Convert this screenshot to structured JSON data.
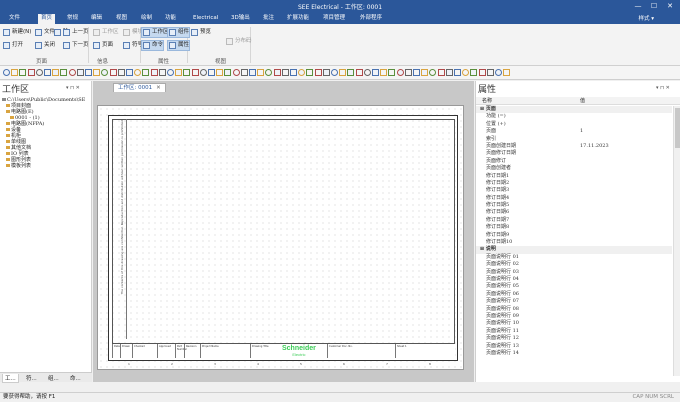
{
  "window": {
    "title": "SEE Electrical - 工作区: 0001",
    "controls": {
      "minimize": "—",
      "maximize": "☐",
      "close": "✕"
    }
  },
  "menu": {
    "items": [
      "文件",
      "首页",
      "常规",
      "编辑",
      "视图",
      "绘制",
      "功能",
      "Electrical",
      "3D输出",
      "批注",
      "扩展功能",
      "项目管理",
      "外部程序"
    ],
    "active_index": 1,
    "style_label": "样式 ▾"
  },
  "ribbon": {
    "buttons": [
      {
        "label": "新建(N)",
        "group": "page",
        "state": "normal"
      },
      {
        "label": "文件",
        "group": "page",
        "state": "normal"
      },
      {
        "label": "除",
        "group": "page",
        "state": "normal"
      },
      {
        "label": "上一页",
        "group": "page",
        "state": "normal"
      },
      {
        "label": "打开",
        "group": "page",
        "state": "normal"
      },
      {
        "label": "关闭",
        "group": "page",
        "state": "normal"
      },
      {
        "label": "下一页",
        "group": "page",
        "state": "normal"
      },
      {
        "label": "工作区",
        "group": "info",
        "state": "disabled"
      },
      {
        "label": "页面",
        "group": "info",
        "state": "normal"
      },
      {
        "label": "模块",
        "group": "info",
        "state": "disabled"
      },
      {
        "label": "符号",
        "group": "info",
        "state": "normal"
      },
      {
        "label": "工作区",
        "group": "props",
        "state": "selected"
      },
      {
        "label": "命令",
        "group": "props",
        "state": "selected"
      },
      {
        "label": "组件",
        "group": "props",
        "state": "selected"
      },
      {
        "label": "属性",
        "group": "props",
        "state": "selected"
      },
      {
        "label": "预览",
        "group": "view",
        "state": "normal"
      },
      {
        "label": "分布码",
        "group": "view",
        "state": "disabled"
      }
    ],
    "groups": [
      "页面",
      "信息",
      "属性",
      "视图"
    ]
  },
  "workspace_panel": {
    "title": "工作区",
    "controls": "▾ ⊓ ✕",
    "tree": [
      {
        "label": "C:\\Users\\Public\\Documents\\SE",
        "level": 0
      },
      {
        "label": "项目封面",
        "level": 1
      },
      {
        "label": "电路图(E)",
        "level": 1
      },
      {
        "label": "0001 - (1)",
        "level": 2
      },
      {
        "label": "电路图(NFPA)",
        "level": 1
      },
      {
        "label": "设备",
        "level": 1
      },
      {
        "label": "机柜",
        "level": 1
      },
      {
        "label": "单线图",
        "level": 1
      },
      {
        "label": "其他文档",
        "level": 1
      },
      {
        "label": "IO 列表",
        "level": 1
      },
      {
        "label": "图形列表",
        "level": 1
      },
      {
        "label": "模板列表",
        "level": 1
      }
    ],
    "tabs": [
      "工...",
      "符...",
      "组...",
      "命..."
    ]
  },
  "document": {
    "tab_label": "工作区: 0001",
    "tab_close": "✕",
    "title_block": {
      "brand": "Schneider",
      "brand_sub": "Electric",
      "cells": [
        "Date",
        "Drawn",
        "Checked",
        "Approved",
        "Part Number",
        "Revision",
        "Project Name",
        "Drawing Title",
        "Customer Doc. No.",
        "Sheet 1"
      ]
    },
    "column_numbers": [
      "1",
      "2",
      "3",
      "4",
      "5",
      "6",
      "7",
      "8"
    ],
    "side_note": "The contents of this drawing are confidential. Reproduction and distribution without written permission is prohibited."
  },
  "properties_panel": {
    "title": "属性",
    "controls": "▾ ⊓ ✕",
    "header": {
      "name": "名称",
      "value": "值"
    },
    "rows": [
      {
        "type": "cat",
        "name": "⊟ 页面",
        "value": ""
      },
      {
        "name": "功能 (=)",
        "value": ""
      },
      {
        "name": "位置 (+)",
        "value": ""
      },
      {
        "name": "页面",
        "value": "1"
      },
      {
        "name": "索引",
        "value": ""
      },
      {
        "name": "页面创建日期",
        "value": "17.11.2023"
      },
      {
        "name": "页面修订日期",
        "value": ""
      },
      {
        "name": "页面修订",
        "value": ""
      },
      {
        "name": "页面创建者",
        "value": ""
      },
      {
        "name": "修订日期1",
        "value": ""
      },
      {
        "name": "修订日期2",
        "value": ""
      },
      {
        "name": "修订日期3",
        "value": ""
      },
      {
        "name": "修订日期4",
        "value": ""
      },
      {
        "name": "修订日期5",
        "value": ""
      },
      {
        "name": "修订日期6",
        "value": ""
      },
      {
        "name": "修订日期7",
        "value": ""
      },
      {
        "name": "修订日期8",
        "value": ""
      },
      {
        "name": "修订日期9",
        "value": ""
      },
      {
        "name": "修订日期10",
        "value": ""
      },
      {
        "type": "cat",
        "name": "⊟ 说明",
        "value": ""
      },
      {
        "name": "页面说明行 01",
        "value": ""
      },
      {
        "name": "页面说明行 02",
        "value": ""
      },
      {
        "name": "页面说明行 03",
        "value": ""
      },
      {
        "name": "页面说明行 04",
        "value": ""
      },
      {
        "name": "页面说明行 05",
        "value": ""
      },
      {
        "name": "页面说明行 06",
        "value": ""
      },
      {
        "name": "页面说明行 07",
        "value": ""
      },
      {
        "name": "页面说明行 08",
        "value": ""
      },
      {
        "name": "页面说明行 09",
        "value": ""
      },
      {
        "name": "页面说明行 10",
        "value": ""
      },
      {
        "name": "页面说明行 11",
        "value": ""
      },
      {
        "name": "页面说明行 12",
        "value": ""
      },
      {
        "name": "页面说明行 13",
        "value": ""
      },
      {
        "name": "页面说明行 14",
        "value": ""
      }
    ]
  },
  "statusbar": {
    "text": "要获得帮助，请按 F1",
    "indicators": "CAP NUM SCRL"
  },
  "colors": {
    "accent": "#2b579a",
    "brand_green": "#3dcd58"
  }
}
